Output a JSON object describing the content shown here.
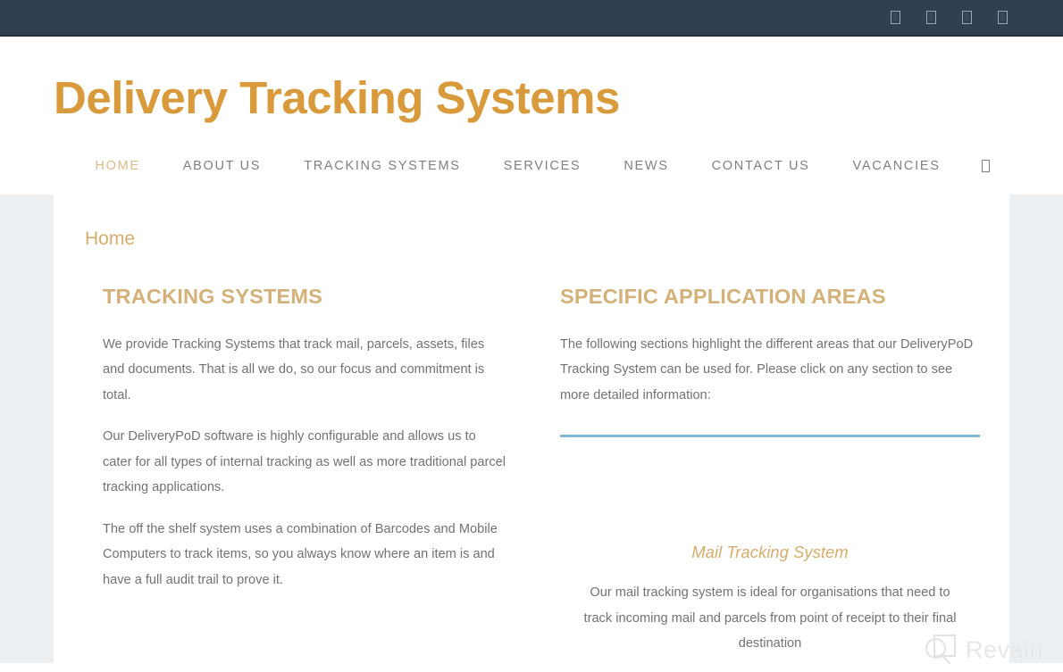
{
  "topbar": {
    "social_icons": [
      {
        "name": "facebook-icon",
        "glyph": "missing-glyph-box"
      },
      {
        "name": "twitter-icon",
        "glyph": "missing-glyph-box"
      },
      {
        "name": "linkedin-icon",
        "glyph": "missing-glyph-box"
      },
      {
        "name": "youtube-icon",
        "glyph": "missing-glyph-box"
      }
    ],
    "background_color": "#2f4052"
  },
  "header": {
    "site_title": "Delivery Tracking Systems",
    "title_color": "#d89a3a"
  },
  "nav": {
    "items": [
      {
        "label": "HOME",
        "active": true
      },
      {
        "label": "ABOUT US",
        "active": false
      },
      {
        "label": "TRACKING SYSTEMS",
        "active": false
      },
      {
        "label": "SERVICES",
        "active": false
      },
      {
        "label": "NEWS",
        "active": false
      },
      {
        "label": "CONTACT US",
        "active": false
      },
      {
        "label": "VACANCIES",
        "active": false
      }
    ],
    "search_icon": "search-icon",
    "active_color": "#d9bc89",
    "inactive_color": "#7b8186"
  },
  "breadcrumb": {
    "text": "Home"
  },
  "left_column": {
    "heading": "TRACKING SYSTEMS",
    "paragraphs": [
      "We provide Tracking Systems that track mail, parcels, assets, files and documents. That is all we do, so our focus and commitment is total.",
      "Our DeliveryPoD software is highly configurable and allows us to cater for all types of internal tracking as well as more traditional parcel tracking applications.",
      "The off the shelf system uses a combination of Barcodes and Mobile Computers to track items, so you always know where an item is and have a full audit trail to prove it."
    ]
  },
  "right_column": {
    "heading": "SPECIFIC APPLICATION AREAS",
    "intro": "The following sections highlight the different areas that our DeliveryPoD Tracking System can be used for. Please click on any section to see more detailed information:",
    "divider_color": "#7fb8d4",
    "section": {
      "title": "Mail Tracking System",
      "body": "Our mail tracking system is ideal for organisations that need to track incoming mail and parcels from point of receipt to their final destination"
    }
  },
  "watermark": {
    "text": "Revain",
    "logo_icon": "magnifier-square-icon"
  },
  "theme": {
    "gutter_color": "#eceff1",
    "body_text_color": "#6e7377",
    "heading_gold": "#d3b179"
  }
}
